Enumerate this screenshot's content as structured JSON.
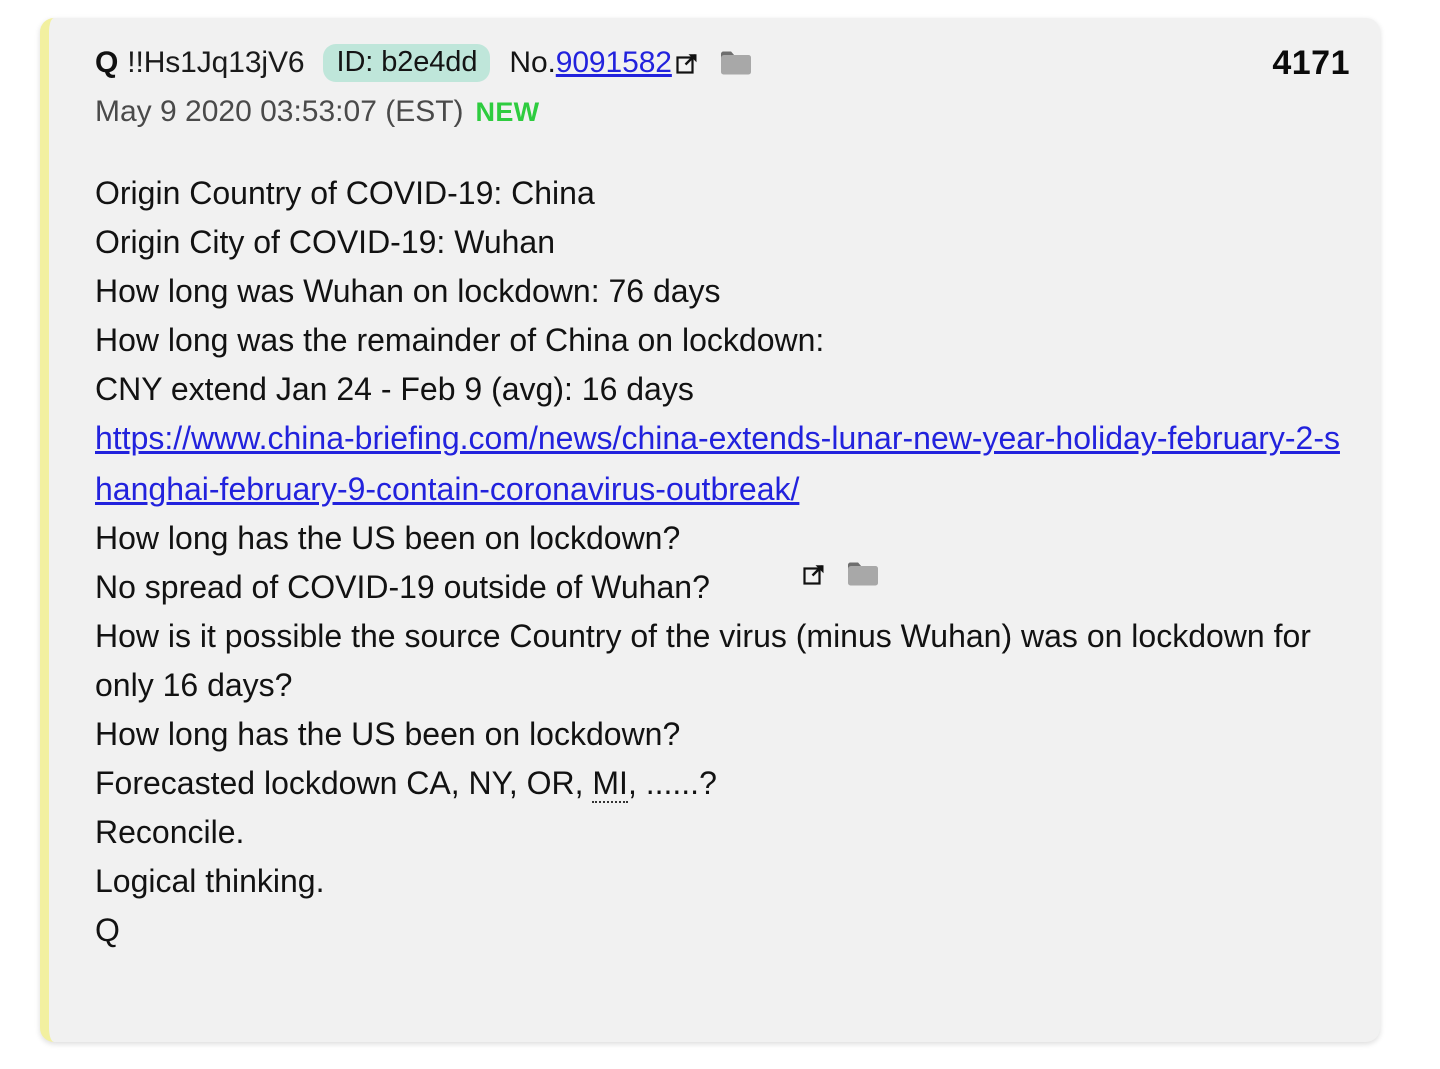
{
  "card": {
    "accent_left_border": "#f2f0a0",
    "background": "#f1f1f1"
  },
  "header": {
    "author": "Q",
    "tripcode": "!!Hs1Jq13jV6",
    "id_label": "ID: b2e4dd",
    "id_badge_color": "#bfe6da",
    "no_prefix": "No.",
    "post_number": "9091582",
    "post_number_color": "#2222dd",
    "timestamp": "May 9 2020 03:53:07 (EST)",
    "new_label": "NEW",
    "new_label_color": "#2ecc3f",
    "post_count": "4171",
    "external_link_icon": "external-link-icon",
    "folder_icon": "folder-icon"
  },
  "body": {
    "lines": [
      "Origin Country of COVID-19: China",
      "Origin City of COVID-19: Wuhan",
      "How long was Wuhan on lockdown: 76 days",
      "How long was the remainder of China on lockdown:",
      "CNY extend Jan 24 - Feb 9 (avg): 16 days"
    ],
    "url": "https://www.china-briefing.com/news/china-extends-lunar-new-year-holiday-february-2-shanghai-february-9-contain-coronavirus-outbreak/",
    "lines_after_url_part1": [
      "How long has the US been on lockdown?",
      "No spread of COVID-19 outside of Wuhan?",
      "How is it possible the source Country of the virus (minus Wuhan) was on lockdown for only 16 days?",
      "How long has the US been on lockdown?"
    ],
    "forecast_prefix": "Forecasted lockdown CA, NY, OR, ",
    "forecast_spellchecked": "MI",
    "forecast_suffix": ", ......?",
    "lines_after_url_part2": [
      "Reconcile.",
      "Logical thinking.",
      "Q"
    ]
  }
}
